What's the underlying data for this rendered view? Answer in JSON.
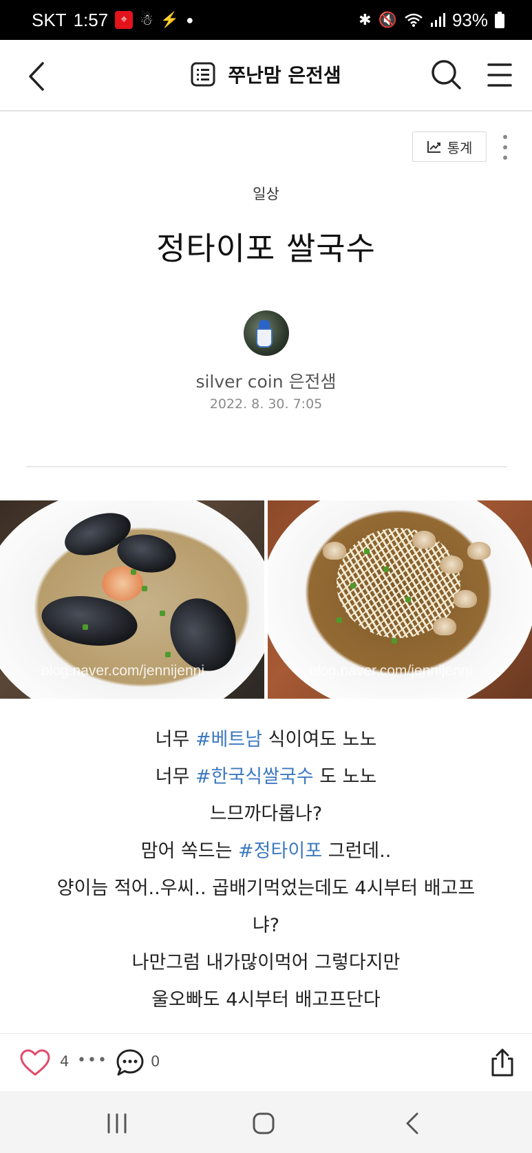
{
  "status_bar": {
    "carrier": "SKT",
    "time": "1:57",
    "battery": "93%",
    "icons": [
      "red-app-icon",
      "snapchat-icon",
      "app-icon",
      "dot-icon",
      "bluetooth-icon",
      "mute-icon",
      "wifi-icon",
      "signal-icon",
      "battery-icon"
    ]
  },
  "header": {
    "blog_title": "쭈난맘 은전샘",
    "icons": [
      "back-icon",
      "list-icon",
      "search-icon",
      "menu-icon"
    ]
  },
  "post": {
    "stats_label": "통계",
    "category": "일상",
    "title": "정타이포 쌀국수",
    "author": "silver coin 은전샘",
    "date": "2022. 8. 30. 7:05",
    "photos": [
      {
        "watermark": "blog.naver.com/jennijenni"
      },
      {
        "watermark": "blog.naver.com/jennijenni"
      }
    ],
    "body": {
      "l1": {
        "pre": "너무 ",
        "tag": "#베트남",
        "post": " 식이여도 노노"
      },
      "l2": {
        "pre": "너무 ",
        "tag": "#한국식쌀국수",
        "post": " 도 노노"
      },
      "l3": "느므까다롭나?",
      "l4": {
        "pre": "맘어 쏙드는 ",
        "tag": "#정타이포",
        "post": " 그런데.."
      },
      "l5": "양이늠 적어..우씨.. 곱배기먹었는데도 4시부터 배고프",
      "l6": "냐?",
      "l7": "나만그럼 내가많이먹어 그렇다지만",
      "l8": "울오빠도 4시부터 배고프단다"
    }
  },
  "actions": {
    "like_count": "4",
    "more": "•••",
    "comment_count": "0"
  },
  "colors": {
    "hashtag": "#3c79c0",
    "like_heart": "#e14b6a",
    "status_bar": "#000000"
  }
}
